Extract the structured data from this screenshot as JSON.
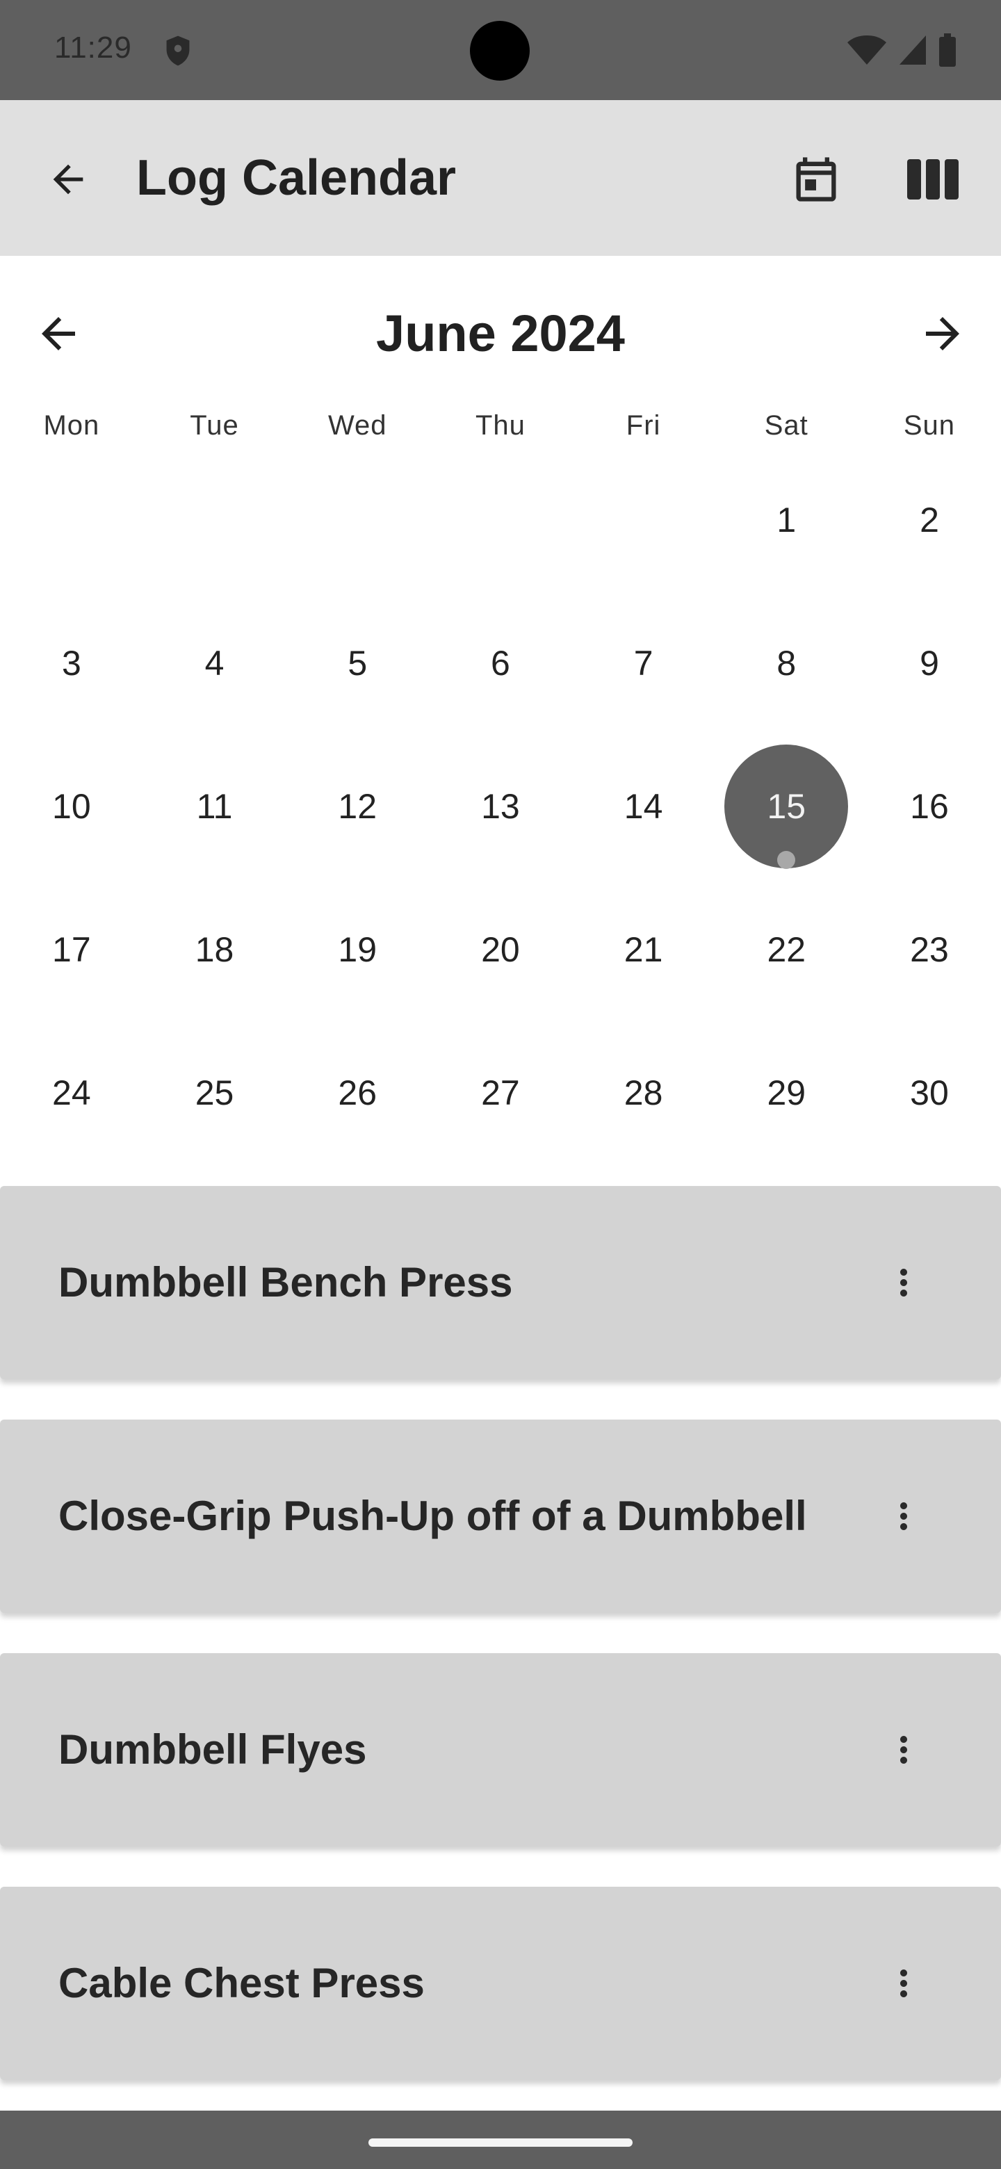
{
  "status_bar": {
    "time": "11:29"
  },
  "app_bar": {
    "title": "Log Calendar"
  },
  "calendar": {
    "month_title": "June 2024",
    "weekdays": [
      "Mon",
      "Tue",
      "Wed",
      "Thu",
      "Fri",
      "Sat",
      "Sun"
    ],
    "weeks": [
      [
        "",
        "",
        "",
        "",
        "",
        "1",
        "2"
      ],
      [
        "3",
        "4",
        "5",
        "6",
        "7",
        "8",
        "9"
      ],
      [
        "10",
        "11",
        "12",
        "13",
        "14",
        "15",
        "16"
      ],
      [
        "17",
        "18",
        "19",
        "20",
        "21",
        "22",
        "23"
      ],
      [
        "24",
        "25",
        "26",
        "27",
        "28",
        "29",
        "30"
      ]
    ],
    "selected_day": "15"
  },
  "exercises": [
    {
      "name": "Dumbbell Bench Press"
    },
    {
      "name": "Close-Grip Push-Up off of a Dumbbell"
    },
    {
      "name": "Dumbbell Flyes"
    },
    {
      "name": "Cable Chest Press"
    }
  ],
  "colors": {
    "app_bar_bg": "#e0e0e0",
    "selected_day_bg": "#616161",
    "card_bg": "#d3d3d3",
    "system_bar_bg": "#5f5f5f"
  },
  "icons": {
    "back": "arrow-left-icon",
    "calendar": "calendar-icon",
    "view": "view-columns-icon",
    "prev_month": "arrow-left-icon",
    "next_month": "arrow-right-icon",
    "more": "more-vert-icon"
  }
}
